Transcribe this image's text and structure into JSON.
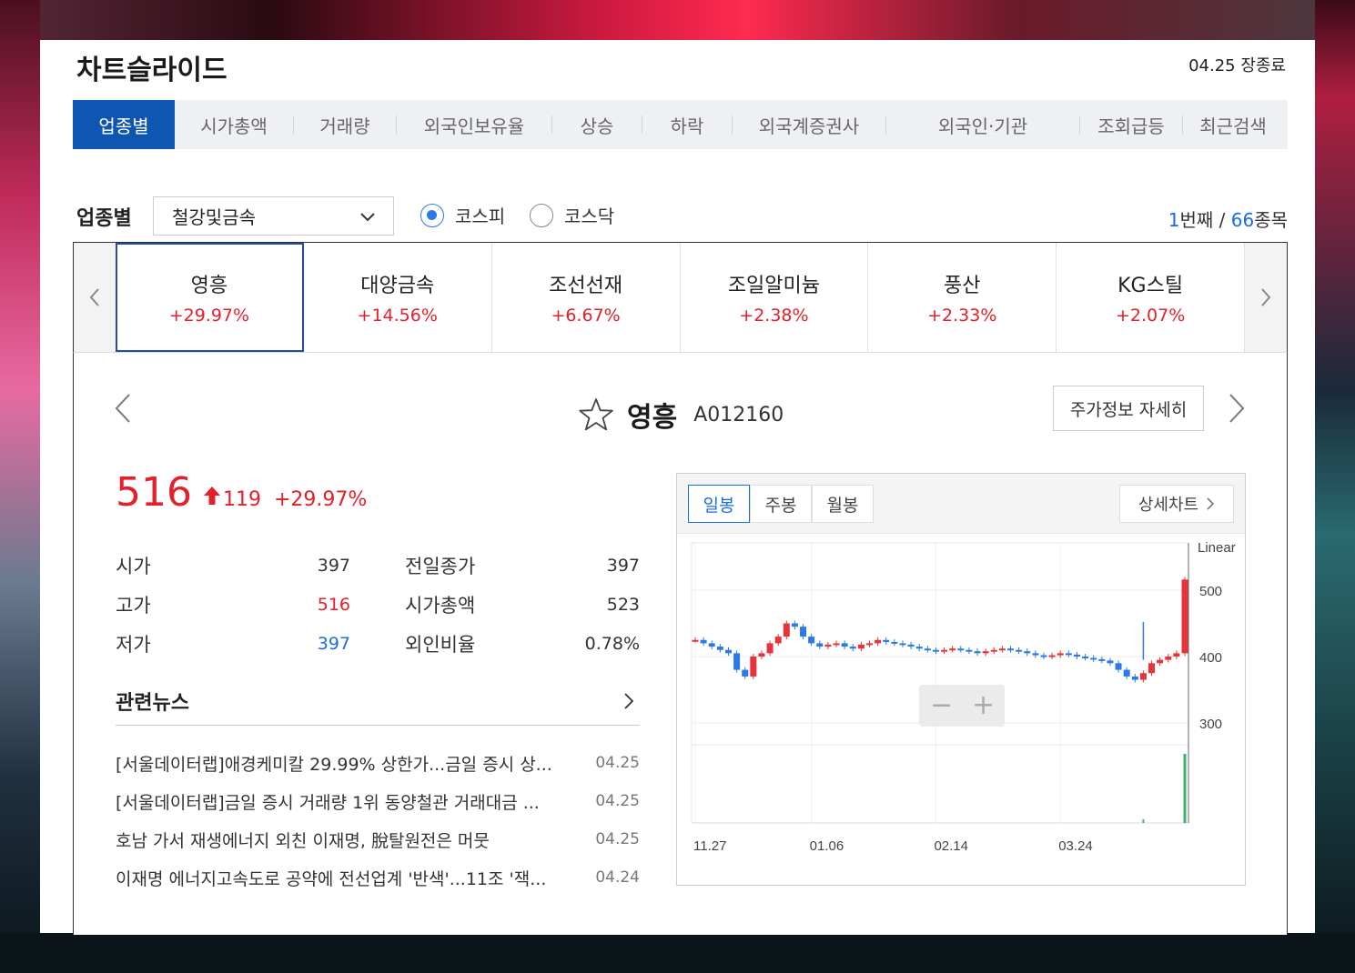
{
  "app": {
    "title": "차트슬라이드",
    "market_status": "04.25 장종료"
  },
  "tabs": [
    {
      "label": "업종별",
      "active": true
    },
    {
      "label": "시가총액"
    },
    {
      "label": "거래량"
    },
    {
      "label": "외국인보유율"
    },
    {
      "label": "상승"
    },
    {
      "label": "하락"
    },
    {
      "label": "외국계증권사"
    },
    {
      "label": "외국인·기관"
    },
    {
      "label": "조회급등"
    },
    {
      "label": "최근검색"
    }
  ],
  "filter": {
    "label": "업종별",
    "sector_selected": "철강및금속",
    "market_options": [
      "코스피",
      "코스닥"
    ],
    "market_selected": "코스피",
    "current_index": "1",
    "sep_unit": "번째 / ",
    "total": "66",
    "total_unit": "종목"
  },
  "stock_strip": [
    {
      "name": "영흥",
      "change": "+29.97%",
      "active": true
    },
    {
      "name": "대양금속",
      "change": "+14.56%"
    },
    {
      "name": "조선선재",
      "change": "+6.67%"
    },
    {
      "name": "조일알미늄",
      "change": "+2.38%"
    },
    {
      "name": "풍산",
      "change": "+2.33%"
    },
    {
      "name": "KG스틸",
      "change": "+2.07%"
    }
  ],
  "stock": {
    "name": "영흥",
    "code": "A012160",
    "detail_button": "주가정보 자세히",
    "price": "516",
    "change": "119",
    "change_pct": "+29.97%",
    "info": [
      {
        "label": "시가",
        "value": "397",
        "label2": "전일종가",
        "value2": "397"
      },
      {
        "label": "고가",
        "value": "516",
        "label2": "시가총액",
        "value2": "523"
      },
      {
        "label": "저가",
        "value": "397",
        "label2": "외인비율",
        "value2": "0.78%"
      }
    ]
  },
  "news": {
    "title": "관련뉴스",
    "items": [
      {
        "headline": "[서울데이터랩]애경케미칼 29.99% 상한가...금일 증시 상...",
        "date": "04.25"
      },
      {
        "headline": "[서울데이터랩]금일 증시 거래량 1위 동양철관 거래대금 ...",
        "date": "04.25"
      },
      {
        "headline": "호남 가서 재생에너지 외친 이재명, 脫탈원전은 머뭇",
        "date": "04.25"
      },
      {
        "headline": "이재명 에너지고속도로 공약에 전선업계 '반색'...11조 '잭...",
        "date": "04.24"
      }
    ]
  },
  "chart": {
    "period_tabs": [
      "일봉",
      "주봉",
      "월봉"
    ],
    "period_selected": "일봉",
    "full_chart_button": "상세차트",
    "scale_label": "Linear",
    "zoom_out": "−",
    "zoom_in": "+",
    "colors": {
      "up": "#e8323c",
      "down": "#2a7ae8",
      "volume": "#3cb371"
    }
  },
  "chart_data": {
    "type": "candlestick",
    "x_ticks": [
      "11.27",
      "01.06",
      "02.14",
      "03.24"
    ],
    "y_ticks": [
      300,
      400,
      500
    ],
    "ylim": [
      300,
      500
    ],
    "close_series": [
      425,
      420,
      415,
      410,
      405,
      380,
      370,
      400,
      405,
      420,
      430,
      450,
      445,
      430,
      420,
      415,
      418,
      420,
      415,
      412,
      418,
      420,
      425,
      422,
      420,
      418,
      415,
      412,
      410,
      408,
      410,
      412,
      410,
      408,
      405,
      408,
      410,
      412,
      410,
      408,
      405,
      402,
      400,
      402,
      405,
      403,
      400,
      398,
      396,
      394,
      390,
      380,
      370,
      365,
      375,
      390,
      395,
      400,
      405,
      516
    ]
  }
}
